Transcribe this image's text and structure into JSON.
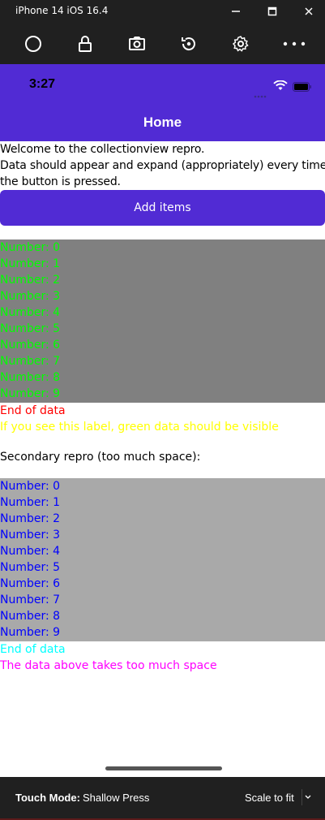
{
  "window": {
    "title": "iPhone 14 iOS 16.4"
  },
  "toolbar": {
    "icons": [
      "home-icon",
      "lock-icon",
      "screenshot-icon",
      "rotate-icon",
      "settings-icon",
      "more-icon"
    ]
  },
  "status": {
    "time": "3:27"
  },
  "nav": {
    "title": "Home"
  },
  "main": {
    "welcome": "Welcome to the collectionview repro.",
    "instructions_1": "Data should appear and expand (appropriately) every time",
    "instructions_2": "the button is pressed.",
    "add_button": "Add items",
    "list1": [
      "Number: 0",
      "Number: 1",
      "Number: 2",
      "Number: 3",
      "Number: 4",
      "Number: 5",
      "Number: 6",
      "Number: 7",
      "Number: 8",
      "Number: 9"
    ],
    "end1": "End of data",
    "note1": "If you see this label, green data should be visible",
    "secondary": "Secondary repro (too much space):",
    "list2": [
      "Number: 0",
      "Number: 1",
      "Number: 2",
      "Number: 3",
      "Number: 4",
      "Number: 5",
      "Number: 6",
      "Number: 7",
      "Number: 8",
      "Number: 9"
    ],
    "end2": "End of data",
    "note2": "The data above takes too much space"
  },
  "bottom": {
    "touch_label": "Touch Mode:",
    "touch_value": "Shallow Press",
    "scale": "Scale to fit"
  },
  "colors": {
    "accent": "#512bd4",
    "list1_bg": "#808080",
    "list1_text": "#00ff00",
    "list2_bg": "#a9a9a9",
    "list2_text": "#0000ff",
    "end1": "#ff0000",
    "note1": "#ffff00",
    "end2": "#00ffff",
    "note2": "#ff00ff"
  }
}
